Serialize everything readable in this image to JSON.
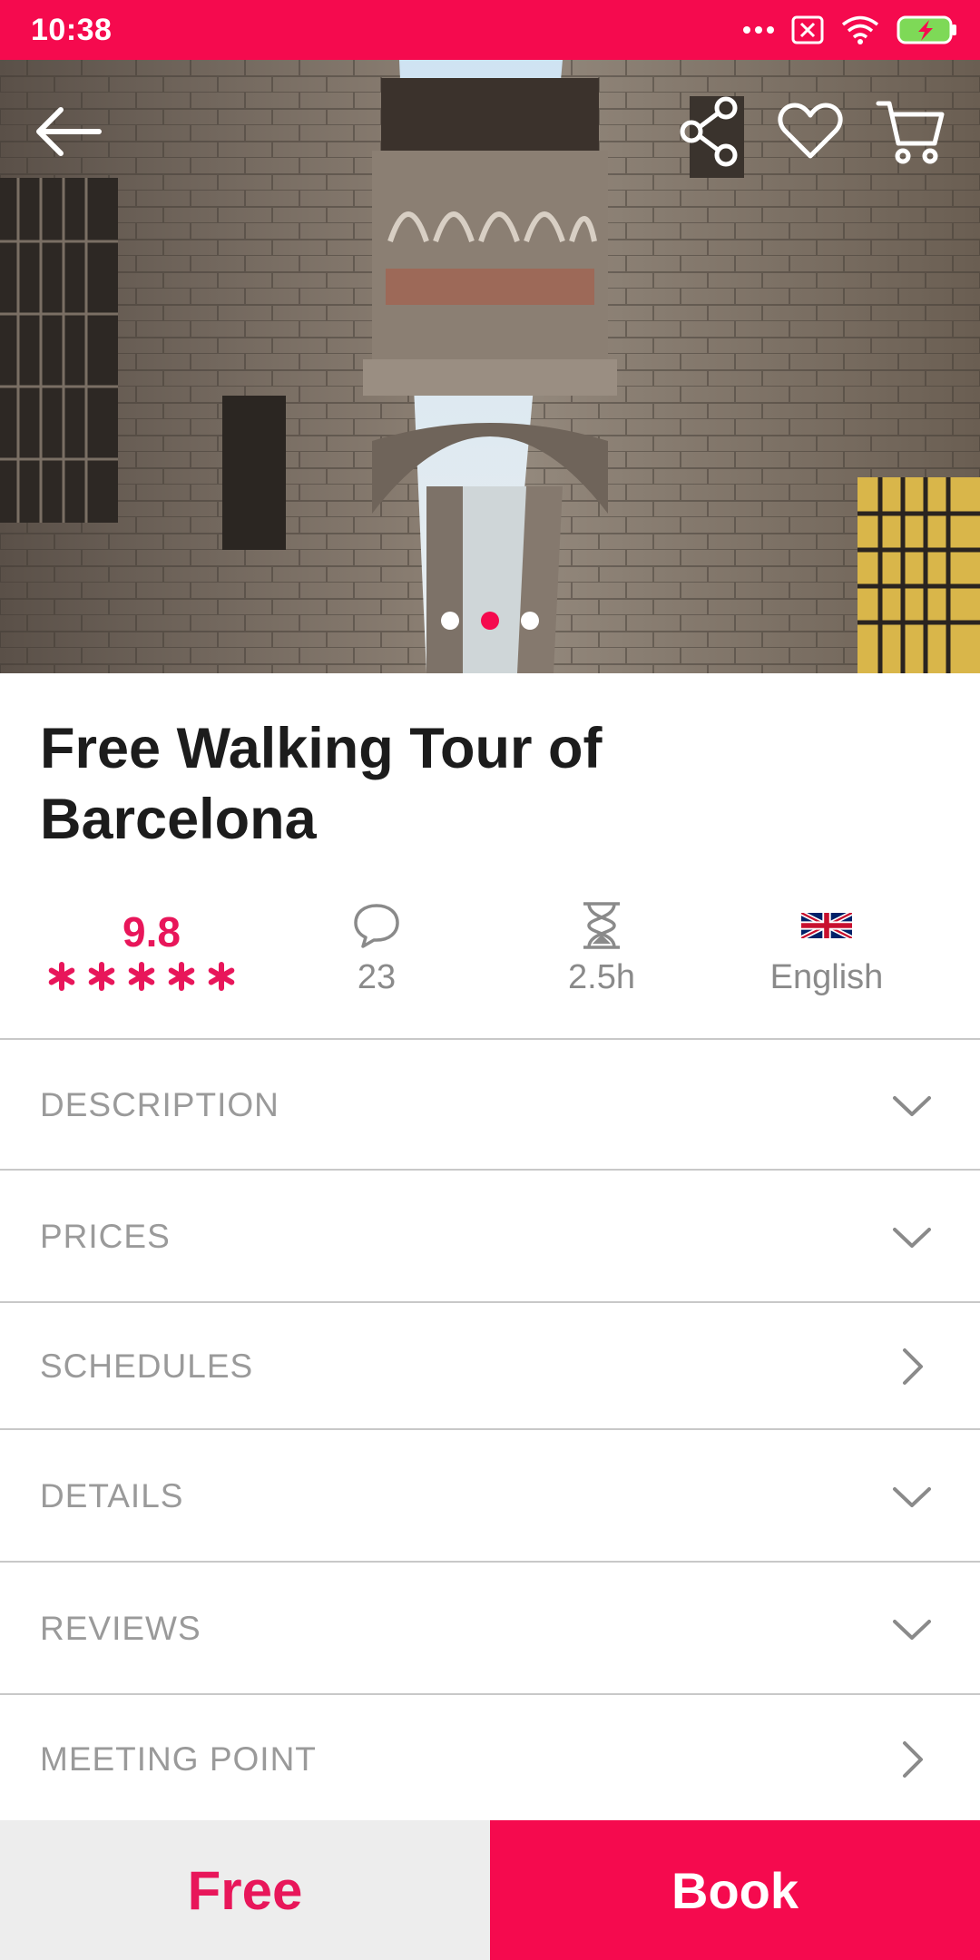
{
  "status_bar": {
    "time": "10:38",
    "icons": [
      "more-dots-icon",
      "sim-blocked-icon",
      "wifi-icon",
      "battery-charging-icon"
    ],
    "color": "#f50a4e"
  },
  "hero": {
    "icons": [
      "back-arrow-icon",
      "share-icon",
      "heart-icon",
      "cart-icon"
    ],
    "carousel": {
      "count": 3,
      "active_index": 1
    }
  },
  "tour": {
    "title": "Free Walking Tour of Barcelona"
  },
  "stats": {
    "rating": {
      "value": "9.8",
      "stars": 5,
      "icon": "star-icon"
    },
    "reviews": {
      "count": "23",
      "icon": "comment-icon"
    },
    "duration": {
      "value": "2.5h",
      "icon": "hourglass-icon"
    },
    "language": {
      "value": "English",
      "icon": "uk-flag-icon"
    }
  },
  "sections": [
    {
      "label": "DESCRIPTION",
      "chevron": "chevron-down-icon"
    },
    {
      "label": "PRICES",
      "chevron": "chevron-down-icon"
    },
    {
      "label": "SCHEDULES",
      "chevron": "chevron-right-icon"
    },
    {
      "label": "DETAILS",
      "chevron": "chevron-down-icon"
    },
    {
      "label": "REVIEWS",
      "chevron": "chevron-down-icon"
    },
    {
      "label": "MEETING POINT",
      "chevron": "chevron-right-icon"
    }
  ],
  "bottom_bar": {
    "price_label": "Free",
    "book_label": "Book"
  },
  "colors": {
    "accent": "#f50a4e",
    "rating": "#e8165a",
    "muted_text": "#8a8a8a",
    "divider": "#c8c8c8",
    "price_bg": "#ededed"
  }
}
